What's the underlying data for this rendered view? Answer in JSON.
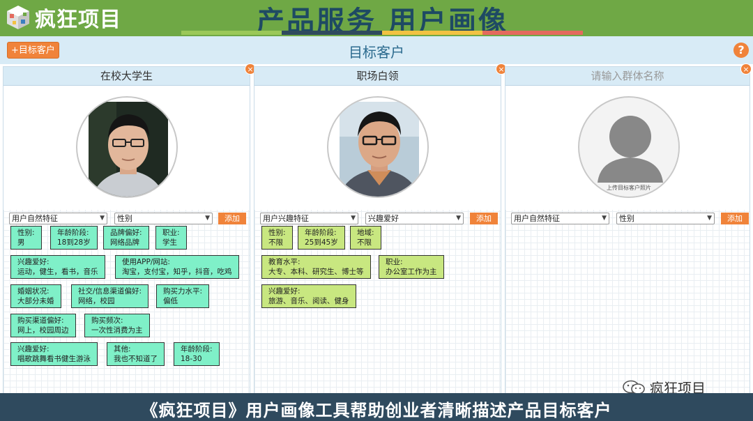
{
  "header": {
    "logo_text": "疯狂项目",
    "banner_title": "产品服务 用户画像",
    "stripe_colors": [
      "#9bc858",
      "#2f4a5e",
      "#f2c242",
      "#e46a5d"
    ]
  },
  "toolbar": {
    "add_button": "+目标客户",
    "section_title": "目标客户",
    "help": "?"
  },
  "cards": [
    {
      "title": "在校大学生",
      "close": "×",
      "select_category": "用户自然特征",
      "select_field": "性别",
      "add_label": "添加",
      "avatar": "student-photo",
      "tags": [
        {
          "text": "性别:\n男"
        },
        {
          "text": "年龄阶段:\n18到28岁"
        },
        {
          "text": "品牌偏好:\n网络品牌"
        },
        {
          "text": "职业:\n学生"
        },
        {
          "text": "兴趣爱好:\n运动，健生，看书，音乐"
        },
        {
          "text": "使用APP/网站:\n淘宝，支付宝，知乎，抖音，吃鸡"
        },
        {
          "text": "婚姻状况:\n大部分未婚"
        },
        {
          "text": "社交/信息渠道偏好:\n网络，校园"
        },
        {
          "text": "购买力水平:\n偏低"
        },
        {
          "text": "购买渠道偏好:\n网上，校园周边"
        },
        {
          "text": "购买频次:\n一次性消费为主"
        },
        {
          "text": "兴趣爱好:\n唱歌跳舞看书健生游泳"
        },
        {
          "text": "其他:\n我也不知道了"
        },
        {
          "text": "年龄阶段:\n18-30"
        }
      ]
    },
    {
      "title": "职场白领",
      "close": "×",
      "select_category": "用户兴趣特征",
      "select_field": "兴趣爱好",
      "add_label": "添加",
      "avatar": "professional-photo",
      "tags": [
        {
          "text": "性别:\n不限"
        },
        {
          "text": "年龄阶段:\n25到45岁"
        },
        {
          "text": "地域:\n不限"
        },
        {
          "text": "教育水平:\n大专、本科、研究生、博士等"
        },
        {
          "text": "职业:\n办公室工作为主"
        },
        {
          "text": "兴趣爱好:\n旅游、音乐、阅读、健身"
        }
      ]
    },
    {
      "title": "请输入群体名称",
      "close": "×",
      "select_category": "用户自然特征",
      "select_field": "性别",
      "add_label": "添加",
      "avatar": "placeholder",
      "avatar_caption": "上传目标客户照片",
      "tags": []
    }
  ],
  "footer": {
    "text": "《疯狂项目》用户画像工具帮助创业者清晰描述产品目标客户"
  },
  "watermark": {
    "text": "疯狂项目"
  }
}
